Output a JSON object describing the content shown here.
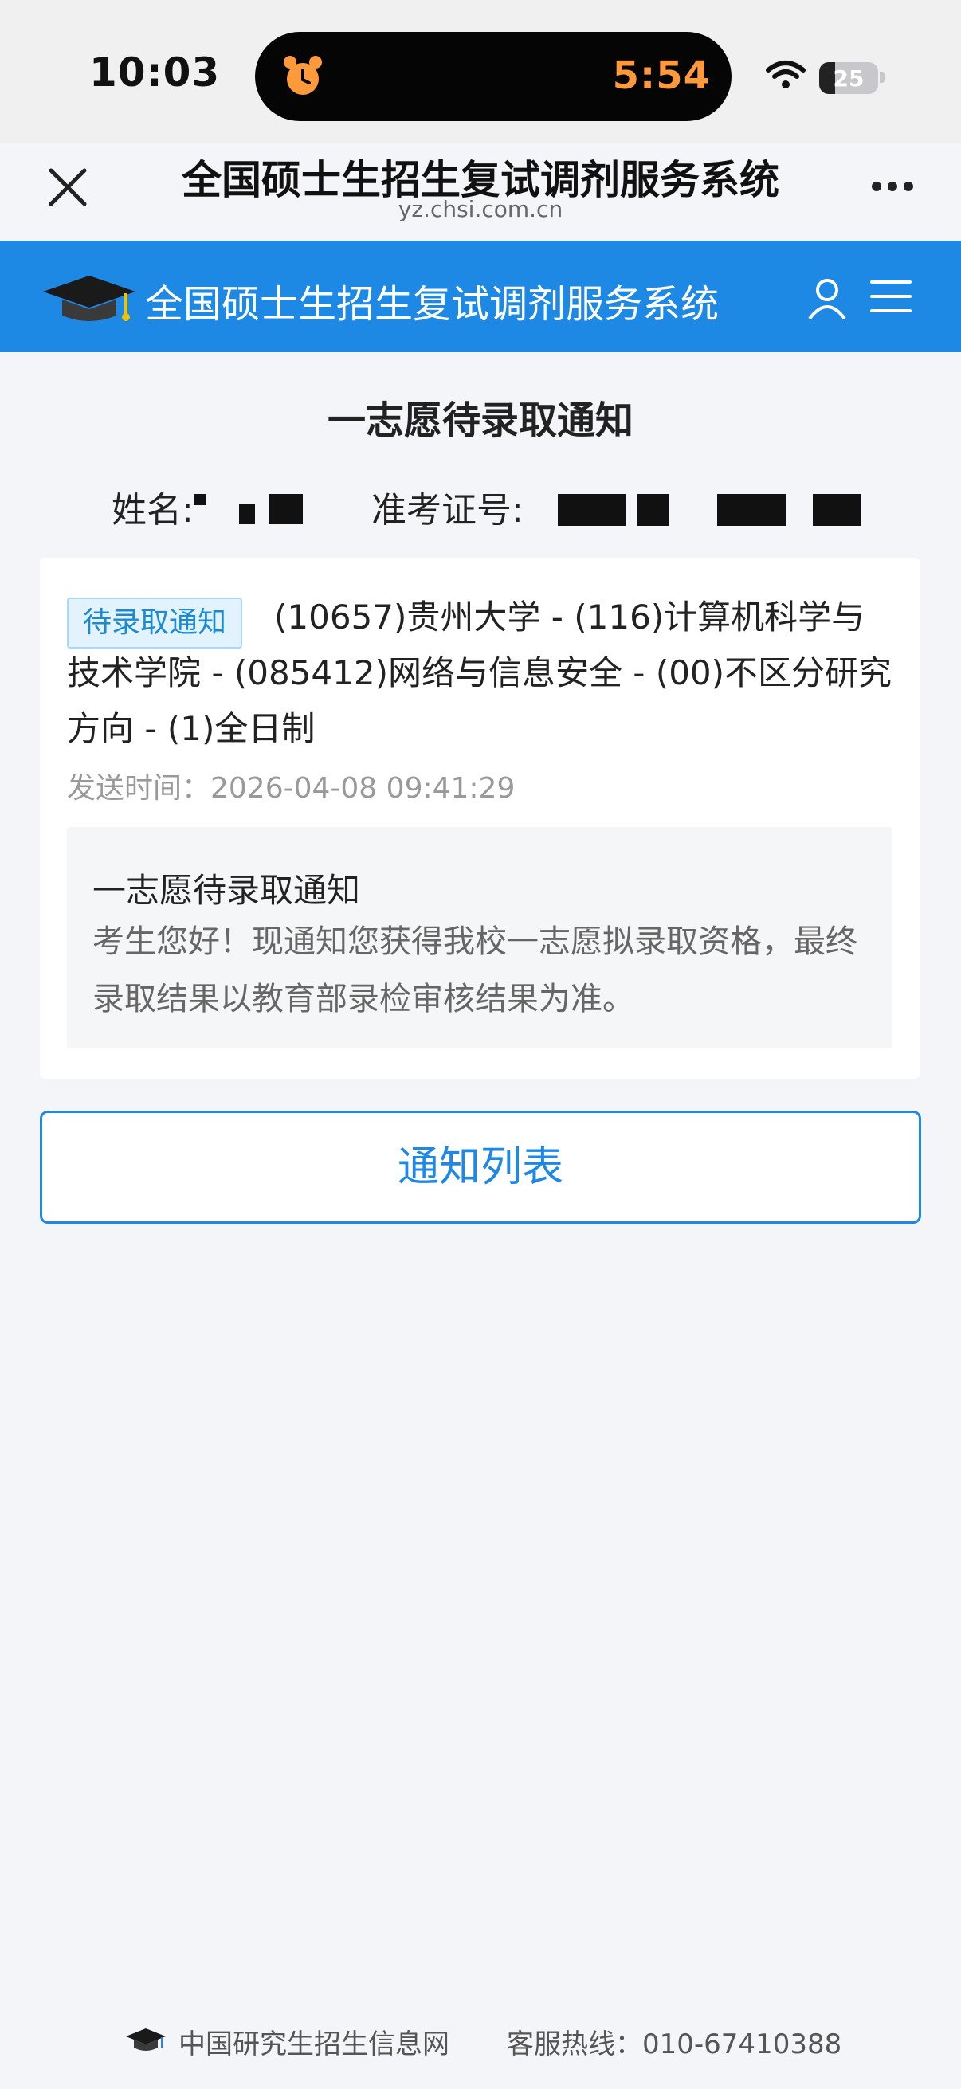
{
  "status_bar": {
    "time": "10:03",
    "timer": "5:54",
    "battery": "25"
  },
  "browser": {
    "title": "全国硕士生招生复试调剂服务系统",
    "url": "yz.chsi.com.cn"
  },
  "app_bar": {
    "title": "全国硕士生招生复试调剂服务系统"
  },
  "page": {
    "heading": "一志愿待录取通知",
    "name_label": "姓名:",
    "exam_id_label": "准考证号:"
  },
  "notification": {
    "tag": "待录取通知",
    "text": "(10657)贵州大学 - (116)计算机科学与技术学院 - (085412)网络与信息安全 - (00)不区分研究方向 - (1)全日制",
    "send_time": "发送时间：2026-04-08 09:41:29",
    "box_title": "一志愿待录取通知",
    "box_body": "考生您好！现通知您获得我校一志愿拟录取资格，最终录取结果以教育部录检审核结果为准。"
  },
  "buttons": {
    "notice_list": "通知列表"
  },
  "footer": {
    "site": "中国研究生招生信息网",
    "hotline": "客服热线：010-67410388"
  },
  "colors": {
    "brand_blue": "#1e88e5",
    "tag_text": "#1a8ad3",
    "timer_orange": "#ff9a3c"
  }
}
